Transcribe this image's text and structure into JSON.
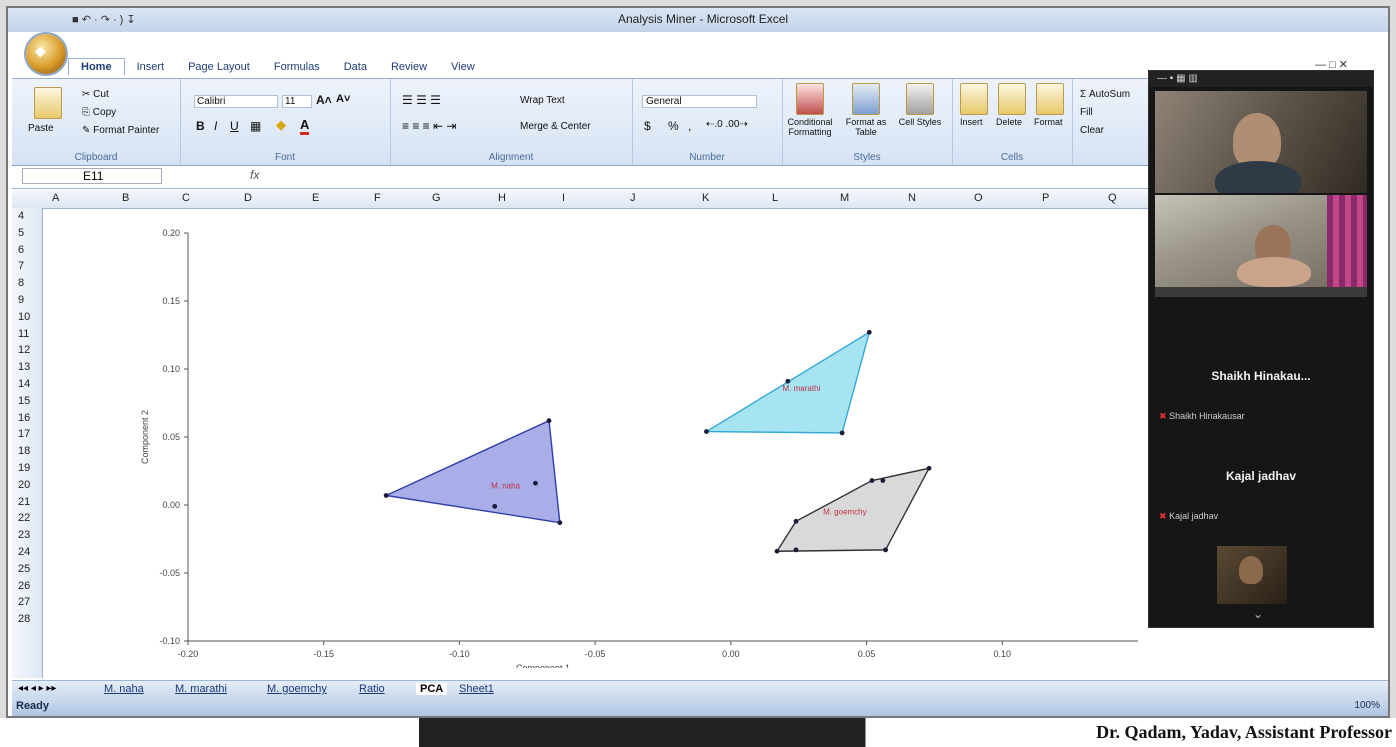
{
  "window": {
    "title": "Analysis Miner - Microsoft Excel",
    "quick_access": "■ ↶ · ↷ · ) ↧",
    "controls": "―  □  ✕",
    "office_button": "❖"
  },
  "ribbon": {
    "tabs": [
      "Home",
      "Insert",
      "Page Layout",
      "Formulas",
      "Data",
      "Review",
      "View"
    ],
    "clipboard": {
      "paste": "Paste",
      "cut": "Cut",
      "copy": "Copy",
      "format_painter": "Format Painter",
      "label": "Clipboard"
    },
    "font": {
      "name": "Calibri",
      "size": "11",
      "bold": "B",
      "italic": "I",
      "underline": "U",
      "label": "Font",
      "grow": "A˄",
      "shrink": "A˅",
      "fill_letter": "A"
    },
    "alignment": {
      "wrap_text": "Wrap Text",
      "merge_center": "Merge & Center",
      "label": "Alignment"
    },
    "number": {
      "format": "General",
      "label": "Number",
      "percent": "%",
      "comma": ","
    },
    "styles": {
      "conditional": "Conditional Formatting",
      "format_table": "Format as Table",
      "cell_styles": "Cell Styles",
      "label": "Styles"
    },
    "cells": {
      "insert": "Insert",
      "delete": "Delete",
      "format": "Format",
      "label": "Cells"
    },
    "editing": {
      "autosum": "Σ AutoSum",
      "fill": "Fill",
      "clear": "Clear"
    }
  },
  "formula_bar": {
    "name_box": "E11",
    "fx": "fx",
    "value": ""
  },
  "columns": [
    "A",
    "B",
    "C",
    "D",
    "E",
    "F",
    "G",
    "H",
    "I",
    "J",
    "K",
    "L",
    "M",
    "N",
    "O",
    "P",
    "Q"
  ],
  "rows": [
    "4",
    "5",
    "6",
    "7",
    "8",
    "9",
    "10",
    "11",
    "12",
    "13",
    "14",
    "15",
    "16",
    "17",
    "18",
    "19",
    "20",
    "21",
    "22",
    "23",
    "24",
    "25",
    "26",
    "27",
    "28"
  ],
  "chart_data": {
    "type": "scatter",
    "title": "",
    "xlabel": "Component 1",
    "ylabel": "Component 2",
    "xlim": [
      -0.2,
      0.15
    ],
    "ylim": [
      -0.1,
      0.2
    ],
    "x_ticks": [
      "-0.20",
      "-0.15",
      "-0.10",
      "-0.05",
      "0.00",
      "0.05",
      "0.10"
    ],
    "y_ticks": [
      "-0.10",
      "-0.05",
      "0.00",
      "0.05",
      "0.10",
      "0.15",
      "0.20"
    ],
    "grid": false,
    "groups": [
      {
        "name": "M. naha",
        "fill": "#a9aee8",
        "stroke": "#2f3fa8",
        "hull": [
          [
            -0.127,
            0.007
          ],
          [
            -0.067,
            0.062
          ],
          [
            -0.063,
            -0.013
          ]
        ],
        "points": [
          [
            -0.127,
            0.007
          ],
          [
            -0.067,
            0.062
          ],
          [
            -0.063,
            -0.013
          ],
          [
            -0.087,
            -0.001
          ],
          [
            -0.072,
            0.016
          ]
        ],
        "label_at": [
          -0.083,
          0.012
        ]
      },
      {
        "name": "M. marathi",
        "fill": "#a6e4f2",
        "stroke": "#34a8d8",
        "hull": [
          [
            -0.009,
            0.054
          ],
          [
            0.051,
            0.127
          ],
          [
            0.041,
            0.053
          ]
        ],
        "points": [
          [
            -0.009,
            0.054
          ],
          [
            0.051,
            0.127
          ],
          [
            0.041,
            0.053
          ],
          [
            0.021,
            0.091
          ]
        ],
        "label_at": [
          0.026,
          0.084
        ]
      },
      {
        "name": "M. goemchy",
        "fill": "#d9d9d9",
        "stroke": "#333333",
        "hull": [
          [
            0.017,
            -0.034
          ],
          [
            0.057,
            -0.033
          ],
          [
            0.073,
            0.027
          ],
          [
            0.052,
            0.018
          ],
          [
            0.024,
            -0.012
          ]
        ],
        "points": [
          [
            0.017,
            -0.034
          ],
          [
            0.024,
            -0.033
          ],
          [
            0.057,
            -0.033
          ],
          [
            0.073,
            0.027
          ],
          [
            0.052,
            0.018
          ],
          [
            0.056,
            0.018
          ],
          [
            0.024,
            -0.012
          ]
        ],
        "label_at": [
          0.042,
          -0.007
        ]
      }
    ]
  },
  "sheet_tabs": [
    "M. naha",
    "M. marathi",
    "M. goemchy",
    "Ratio",
    "PCA",
    "Sheet1"
  ],
  "active_sheet": "PCA",
  "status": {
    "left": "Ready",
    "zoom": "100%"
  },
  "meeting": {
    "tile_names": [
      "Shaikh Hinakau...",
      "Kajal jadhav"
    ],
    "tile_subs": [
      "Shaikh Hinakausar",
      "Kajal jadhav"
    ]
  },
  "caption_fragment": "Dr. Qadam, Yadav, Assistant Professor"
}
